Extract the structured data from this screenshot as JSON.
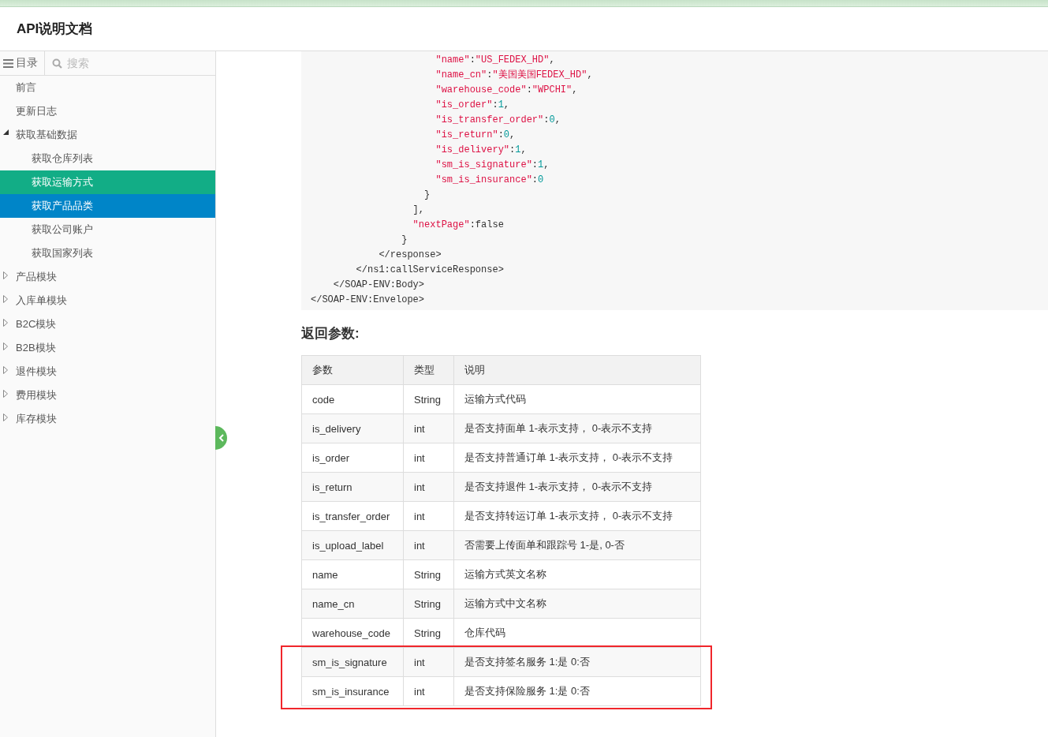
{
  "header": {
    "title": "API说明文档"
  },
  "sidebar": {
    "tabs": [
      {
        "label": "目录",
        "selected": true
      }
    ],
    "search": {
      "placeholder": "搜索"
    },
    "items": [
      {
        "label": "前言",
        "selected": false
      },
      {
        "label": "更新日志",
        "selected": false
      },
      {
        "label": "获取基础数据",
        "expanded": true,
        "children": [
          {
            "label": "获取仓库列表",
            "selected": false
          },
          {
            "label": "获取运输方式",
            "selected": true
          },
          {
            "label": "获取产品品类",
            "hovered": true,
            "selected": false
          },
          {
            "label": "获取公司账户",
            "selected": false
          },
          {
            "label": "获取国家列表",
            "selected": false
          }
        ]
      },
      {
        "label": "产品模块",
        "expanded": false
      },
      {
        "label": "入库单模块",
        "expanded": false
      },
      {
        "label": "B2C模块",
        "expanded": false
      },
      {
        "label": "B2B模块",
        "expanded": false
      },
      {
        "label": "退件模块",
        "expanded": false
      },
      {
        "label": "费用模块",
        "expanded": false
      },
      {
        "label": "库存模块",
        "expanded": false
      }
    ]
  },
  "code_block": {
    "lines": [
      [
        {
          "kind": "string",
          "text": "                      \"name\""
        },
        {
          "kind": "plain",
          "text": ":"
        },
        {
          "kind": "string",
          "text": "\"US_FEDEX_HD\""
        },
        {
          "kind": "plain",
          "text": ","
        }
      ],
      [
        {
          "kind": "string",
          "text": "                      \"name_cn\""
        },
        {
          "kind": "plain",
          "text": ":"
        },
        {
          "kind": "string",
          "text": "\"美国美国FEDEX_HD\""
        },
        {
          "kind": "plain",
          "text": ","
        }
      ],
      [
        {
          "kind": "string",
          "text": "                      \"warehouse_code\""
        },
        {
          "kind": "plain",
          "text": ":"
        },
        {
          "kind": "string",
          "text": "\"WPCHI\""
        },
        {
          "kind": "plain",
          "text": ","
        }
      ],
      [
        {
          "kind": "string",
          "text": "                      \"is_order\""
        },
        {
          "kind": "plain",
          "text": ":"
        },
        {
          "kind": "number",
          "text": "1"
        },
        {
          "kind": "plain",
          "text": ","
        }
      ],
      [
        {
          "kind": "string",
          "text": "                      \"is_transfer_order\""
        },
        {
          "kind": "plain",
          "text": ":"
        },
        {
          "kind": "number",
          "text": "0"
        },
        {
          "kind": "plain",
          "text": ","
        }
      ],
      [
        {
          "kind": "string",
          "text": "                      \"is_return\""
        },
        {
          "kind": "plain",
          "text": ":"
        },
        {
          "kind": "number",
          "text": "0"
        },
        {
          "kind": "plain",
          "text": ","
        }
      ],
      [
        {
          "kind": "string",
          "text": "                      \"is_delivery\""
        },
        {
          "kind": "plain",
          "text": ":"
        },
        {
          "kind": "number",
          "text": "1"
        },
        {
          "kind": "plain",
          "text": ","
        }
      ],
      [
        {
          "kind": "string",
          "text": "                      \"sm_is_signature\""
        },
        {
          "kind": "plain",
          "text": ":"
        },
        {
          "kind": "number",
          "text": "1"
        },
        {
          "kind": "plain",
          "text": ","
        }
      ],
      [
        {
          "kind": "string",
          "text": "                      \"sm_is_insurance\""
        },
        {
          "kind": "plain",
          "text": ":"
        },
        {
          "kind": "number",
          "text": "0"
        }
      ],
      [
        {
          "kind": "plain",
          "text": "                    }"
        }
      ],
      [
        {
          "kind": "plain",
          "text": "                  ],"
        }
      ],
      [
        {
          "kind": "string",
          "text": "                  \"nextPage\""
        },
        {
          "kind": "plain",
          "text": ":"
        },
        {
          "kind": "keyword",
          "text": "false"
        }
      ],
      [
        {
          "kind": "plain",
          "text": "                }"
        }
      ],
      [
        {
          "kind": "plain",
          "text": "            </response>"
        }
      ],
      [
        {
          "kind": "plain",
          "text": "        </ns1:callServiceResponse>"
        }
      ],
      [
        {
          "kind": "plain",
          "text": "    </SOAP-ENV:Body>"
        }
      ],
      [
        {
          "kind": "plain",
          "text": "</SOAP-ENV:Envelope>"
        }
      ]
    ]
  },
  "section_heading": "返回参数:",
  "table": {
    "columns": [
      "参数",
      "类型",
      "说明"
    ],
    "rows": [
      {
        "cells": [
          "code",
          "String",
          "运输方式代码"
        ],
        "highlighted": false
      },
      {
        "cells": [
          "is_delivery",
          "int",
          "是否支持面单 1-表示支持， 0-表示不支持"
        ],
        "highlighted": false
      },
      {
        "cells": [
          "is_order",
          "int",
          "是否支持普通订单 1-表示支持， 0-表示不支持"
        ],
        "highlighted": false
      },
      {
        "cells": [
          "is_return",
          "int",
          "是否支持退件 1-表示支持， 0-表示不支持"
        ],
        "highlighted": false
      },
      {
        "cells": [
          "is_transfer_order",
          "int",
          "是否支持转运订单 1-表示支持， 0-表示不支持"
        ],
        "highlighted": false
      },
      {
        "cells": [
          "is_upload_label",
          "int",
          "否需要上传面单和跟踪号 1-是, 0-否"
        ],
        "highlighted": false
      },
      {
        "cells": [
          "name",
          "String",
          "运输方式英文名称"
        ],
        "highlighted": false
      },
      {
        "cells": [
          "name_cn",
          "String",
          "运输方式中文名称"
        ],
        "highlighted": false
      },
      {
        "cells": [
          "warehouse_code",
          "String",
          "仓库代码"
        ],
        "highlighted": false
      },
      {
        "cells": [
          "sm_is_signature",
          "int",
          "是否支持签名服务 1:是 0:否"
        ],
        "highlighted": true
      },
      {
        "cells": [
          "sm_is_insurance",
          "int",
          "是否支持保险服务 1:是 0:否"
        ],
        "highlighted": true
      }
    ]
  }
}
